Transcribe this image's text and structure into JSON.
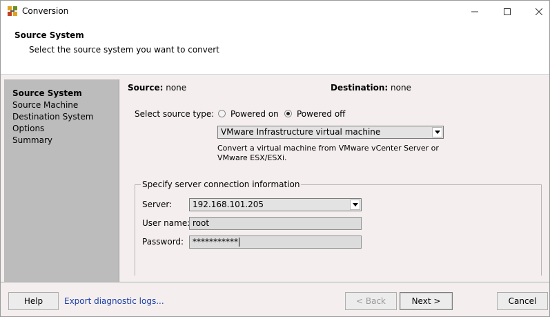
{
  "window": {
    "title": "Conversion",
    "controls": {
      "minimize": "minimize",
      "maximize": "maximize",
      "close": "close"
    }
  },
  "header": {
    "title": "Source System",
    "subtitle": "Select the source system you want to convert"
  },
  "nav": {
    "items": [
      {
        "label": "Source System",
        "active": true
      },
      {
        "label": "Source Machine",
        "active": false
      },
      {
        "label": "Destination System",
        "active": false
      },
      {
        "label": "Options",
        "active": false
      },
      {
        "label": "Summary",
        "active": false
      }
    ]
  },
  "summary": {
    "source_label": "Source:",
    "source_value": "none",
    "destination_label": "Destination:",
    "destination_value": "none"
  },
  "source_type": {
    "label": "Select source type:",
    "options": [
      {
        "label": "Powered on",
        "checked": false
      },
      {
        "label": "Powered off",
        "checked": true
      }
    ],
    "selected": "VMware Infrastructure virtual machine",
    "description": "Convert a virtual machine from VMware vCenter Server or VMware ESX/ESXi."
  },
  "connection": {
    "legend": "Specify server connection information",
    "server_label": "Server:",
    "server_value": "192.168.101.205",
    "username_label": "User name:",
    "username_value": "root",
    "password_label": "Password:",
    "password_value": "***********"
  },
  "footer": {
    "help_label": "Help",
    "export_link": "Export diagnostic logs...",
    "back_label": "< Back",
    "next_label": "Next >",
    "cancel_label": "Cancel"
  },
  "colors": {
    "panel_bg": "#f4eeee",
    "nav_bg": "#bcbcbc",
    "link": "#1a3fa8"
  }
}
